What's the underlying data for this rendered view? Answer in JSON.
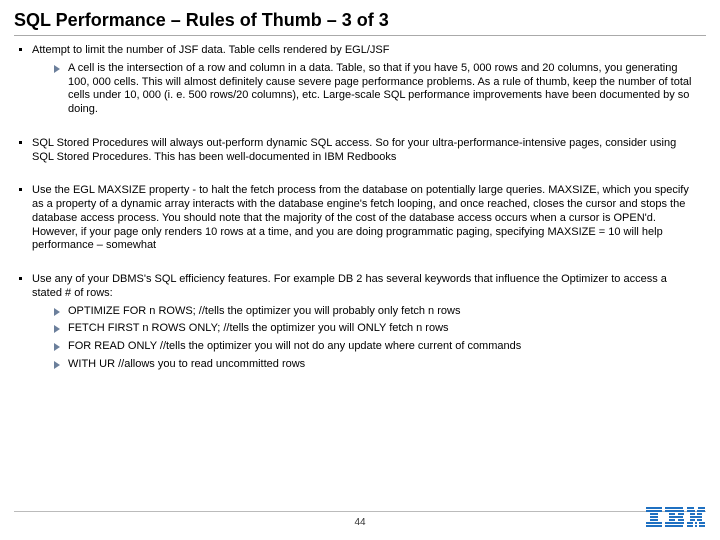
{
  "title": "SQL Performance – Rules of Thumb – 3 of 3",
  "bullets": [
    {
      "text": "Attempt to limit the number of JSF data. Table cells rendered by EGL/JSF",
      "sub": [
        "A cell is the intersection of a row and column in a data. Table, so that if you have 5, 000 rows and 20 columns, you generating 100, 000 cells.  This will almost definitely cause severe page performance problems.  As a rule of thumb, keep the number of total cells under 10, 000 (i. e. 500 rows/20 columns), etc.  Large-scale SQL performance improvements have been documented by so doing."
      ]
    },
    {
      "text": "SQL Stored Procedures will always out-perform dynamic SQL access. So for your ultra-performance-intensive pages, consider using SQL Stored Procedures. This has been well-documented in IBM Redbooks",
      "sub": []
    },
    {
      "text": "Use the EGL MAXSIZE property - to halt the fetch process from the database on potentially large queries. MAXSIZE, which you specify as a property of a dynamic array interacts with the database engine's fetch looping, and once reached, closes the cursor and stops the database access process.  You should note that the majority of the cost of the database access occurs when a cursor is OPEN'd. However, if your page only renders 10 rows at a time, and you are doing programmatic paging, specifying MAXSIZE = 10 will help performance – somewhat",
      "sub": []
    },
    {
      "text": "Use any of your DBMS's SQL efficiency features.  For example DB 2 has several keywords that influence the Optimizer to access a stated # of rows:",
      "sub": [
        "OPTIMIZE FOR n ROWS;   //tells the optimizer you will probably only fetch n rows",
        "FETCH FIRST n ROWS ONLY;   //tells the optimizer you will ONLY fetch n rows",
        "FOR READ ONLY   //tells the optimizer you will not do any update where current of commands",
        "WITH  UR  //allows you to read uncommitted rows"
      ]
    }
  ],
  "page_number": "44"
}
